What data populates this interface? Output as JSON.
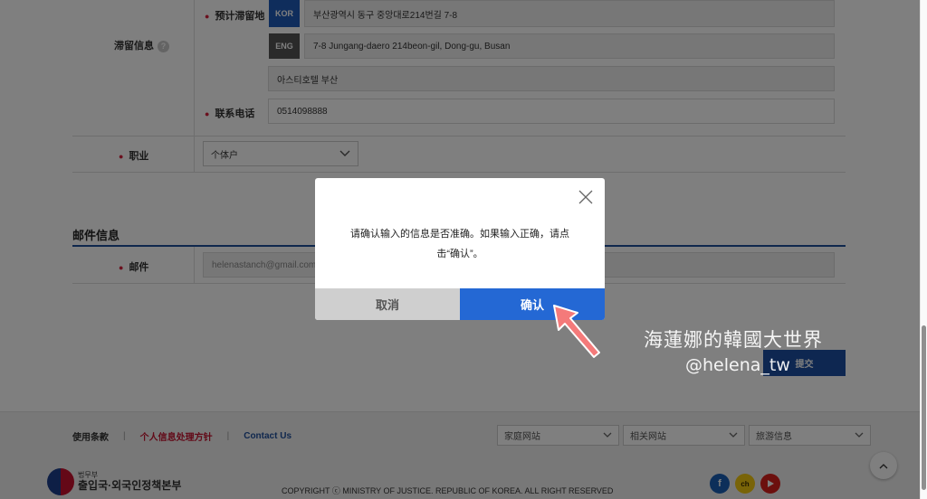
{
  "stay_section": {
    "label": "滞留信息",
    "help_icon": "?",
    "address_label": "预计滞留地",
    "kor_badge": "KOR",
    "kor_value": "부산광역시 동구 중앙대로214번길 7-8",
    "eng_badge": "ENG",
    "eng_value": "7-8 Jungang-daero 214beon-gil, Dong-gu, Busan",
    "hotel_value": "아스티호텔 부산",
    "phone_label": "联系电话",
    "phone_value": "0514098888"
  },
  "job": {
    "label": "职业",
    "selected": "个体户"
  },
  "email_section": {
    "title": "邮件信息",
    "label": "邮件",
    "value": "helenastanch@gmail.com"
  },
  "submit_label": "提交",
  "dialog": {
    "message_line1": "请确认输入的信息是否准确。如果输入正确，请点",
    "message_line2": "击“确认”。",
    "cancel_label": "取消",
    "ok_label": "确认"
  },
  "watermark": {
    "line1": "海蓮娜的韓國大世界",
    "line2": "@helena_tw"
  },
  "footer": {
    "terms": "使用条款",
    "privacy": "个人信息处理方针",
    "contact": "Contact Us",
    "select1": "家庭网站",
    "select2": "相关网站",
    "select3": "旅游信息",
    "logo_small": "법무부",
    "logo_main": "출입국·외국인정책본부",
    "copyright": "COPYRIGHT ⓒ MINISTRY OF JUSTICE. REPUBLIC OF KOREA. ALL RIGHT RESERVED"
  },
  "colors": {
    "accent_blue": "#2468d4",
    "required_red": "#d6213c",
    "kor_badge": "#1f5bb8",
    "eng_badge": "#555555",
    "arrow": "#f47a7a"
  },
  "icons": {
    "close": "close-icon",
    "chevron": "chevron-down-icon",
    "scroll_top": "chevron-up-icon"
  }
}
